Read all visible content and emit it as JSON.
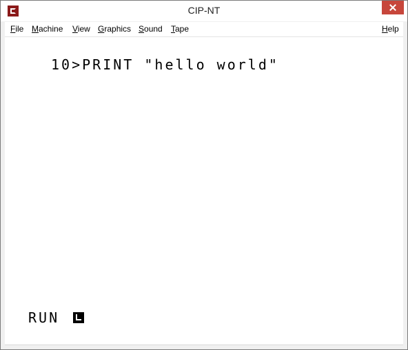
{
  "window": {
    "title": "CIP-NT",
    "app_icon": "cip-app-icon",
    "close_icon": "close-icon",
    "accent_color": "#8b1a1a",
    "close_color": "#c7463b"
  },
  "menubar": {
    "items": [
      {
        "label": "File"
      },
      {
        "label": "Machine"
      },
      {
        "label": "View"
      },
      {
        "label": "Graphics"
      },
      {
        "label": "Sound"
      },
      {
        "label": "Tape"
      },
      {
        "label": "Help"
      }
    ]
  },
  "screen": {
    "program_line": "10>PRINT \"hello world\"",
    "command_line": "RUN",
    "cursor_icon": "cursor-block-icon"
  }
}
